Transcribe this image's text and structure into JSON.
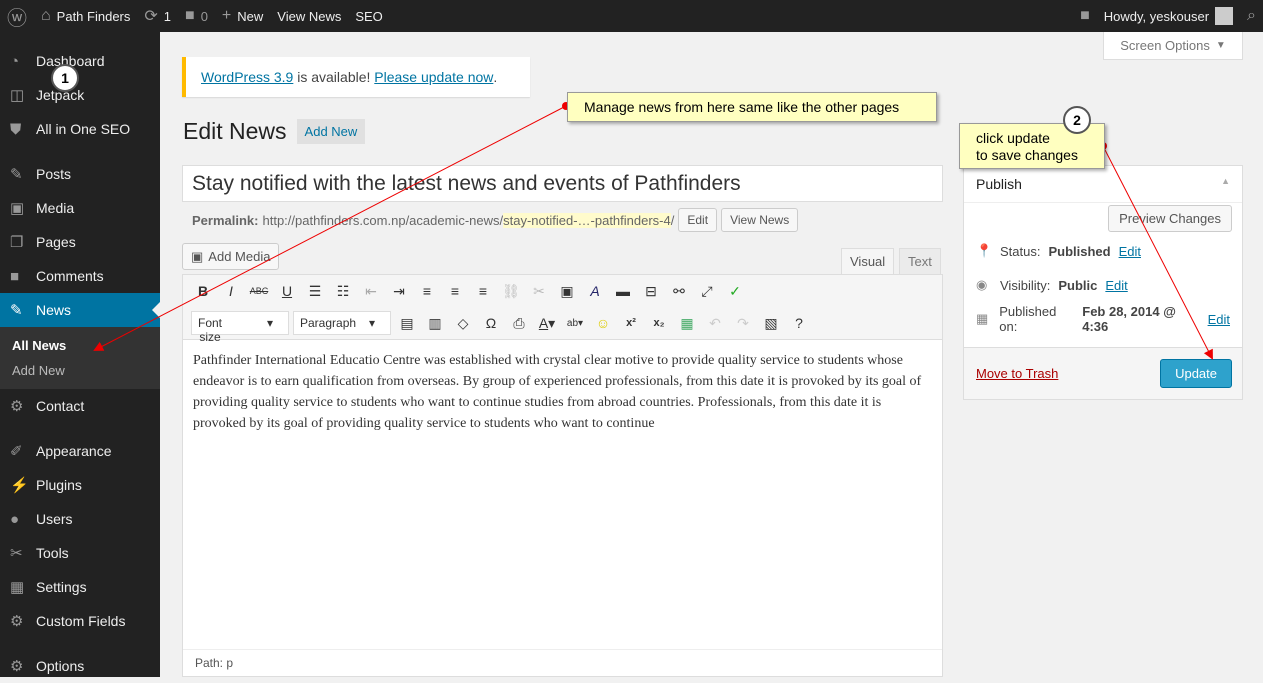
{
  "adminbar": {
    "site": "Path Finders",
    "updates": "1",
    "comments": "0",
    "new": "New",
    "view": "View News",
    "seo": "SEO",
    "howdy": "Howdy, yeskouser"
  },
  "sidebar": {
    "items": [
      "Dashboard",
      "Jetpack",
      "All in One SEO",
      "Posts",
      "Media",
      "Pages",
      "Comments",
      "News",
      "Contact",
      "Appearance",
      "Plugins",
      "Users",
      "Tools",
      "Settings",
      "Custom Fields",
      "Options"
    ],
    "sub": [
      "All News",
      "Add New"
    ]
  },
  "screen_options": "Screen Options",
  "notice": {
    "link1": "WordPress 3.9",
    "text": " is available! ",
    "link2": "Please update now",
    "end": "."
  },
  "page": {
    "title": "Edit News",
    "add_new": "Add New"
  },
  "post": {
    "title": "Stay notified with the latest news and events of Pathfinders",
    "permalink_label": "Permalink:",
    "permalink_base": "http://pathfinders.com.np/academic-news/",
    "permalink_slug": "stay-notified-…-pathfinders-4",
    "permalink_end": "/",
    "edit": "Edit",
    "view": "View News"
  },
  "editor": {
    "add_media": "Add Media",
    "tab_visual": "Visual",
    "tab_text": "Text",
    "font_size": "Font size",
    "paragraph": "Paragraph",
    "content": "Pathfinder International Educatio Centre was established with crystal clear motive to provide quality service to students whose endeavor is to earn qualification from overseas. By group of experienced professionals, from this date it is provoked by its goal of providing quality service to students who want to continue studies from abroad countries. Professionals, from this date it is provoked by its goal of providing quality service to students who want to continue",
    "path": "Path: p"
  },
  "publish": {
    "title": "Publish",
    "preview": "Preview Changes",
    "status_label": "Status:",
    "status": "Published",
    "visibility_label": "Visibility:",
    "visibility": "Public",
    "published_label": "Published on:",
    "published": "Feb 28, 2014 @ 4:36",
    "edit": "Edit",
    "trash": "Move to Trash",
    "update": "Update"
  },
  "callouts": {
    "c1": "Manage news from here same like the other pages",
    "c2": "click update\nto save changes",
    "n1": "1",
    "n2": "2"
  }
}
